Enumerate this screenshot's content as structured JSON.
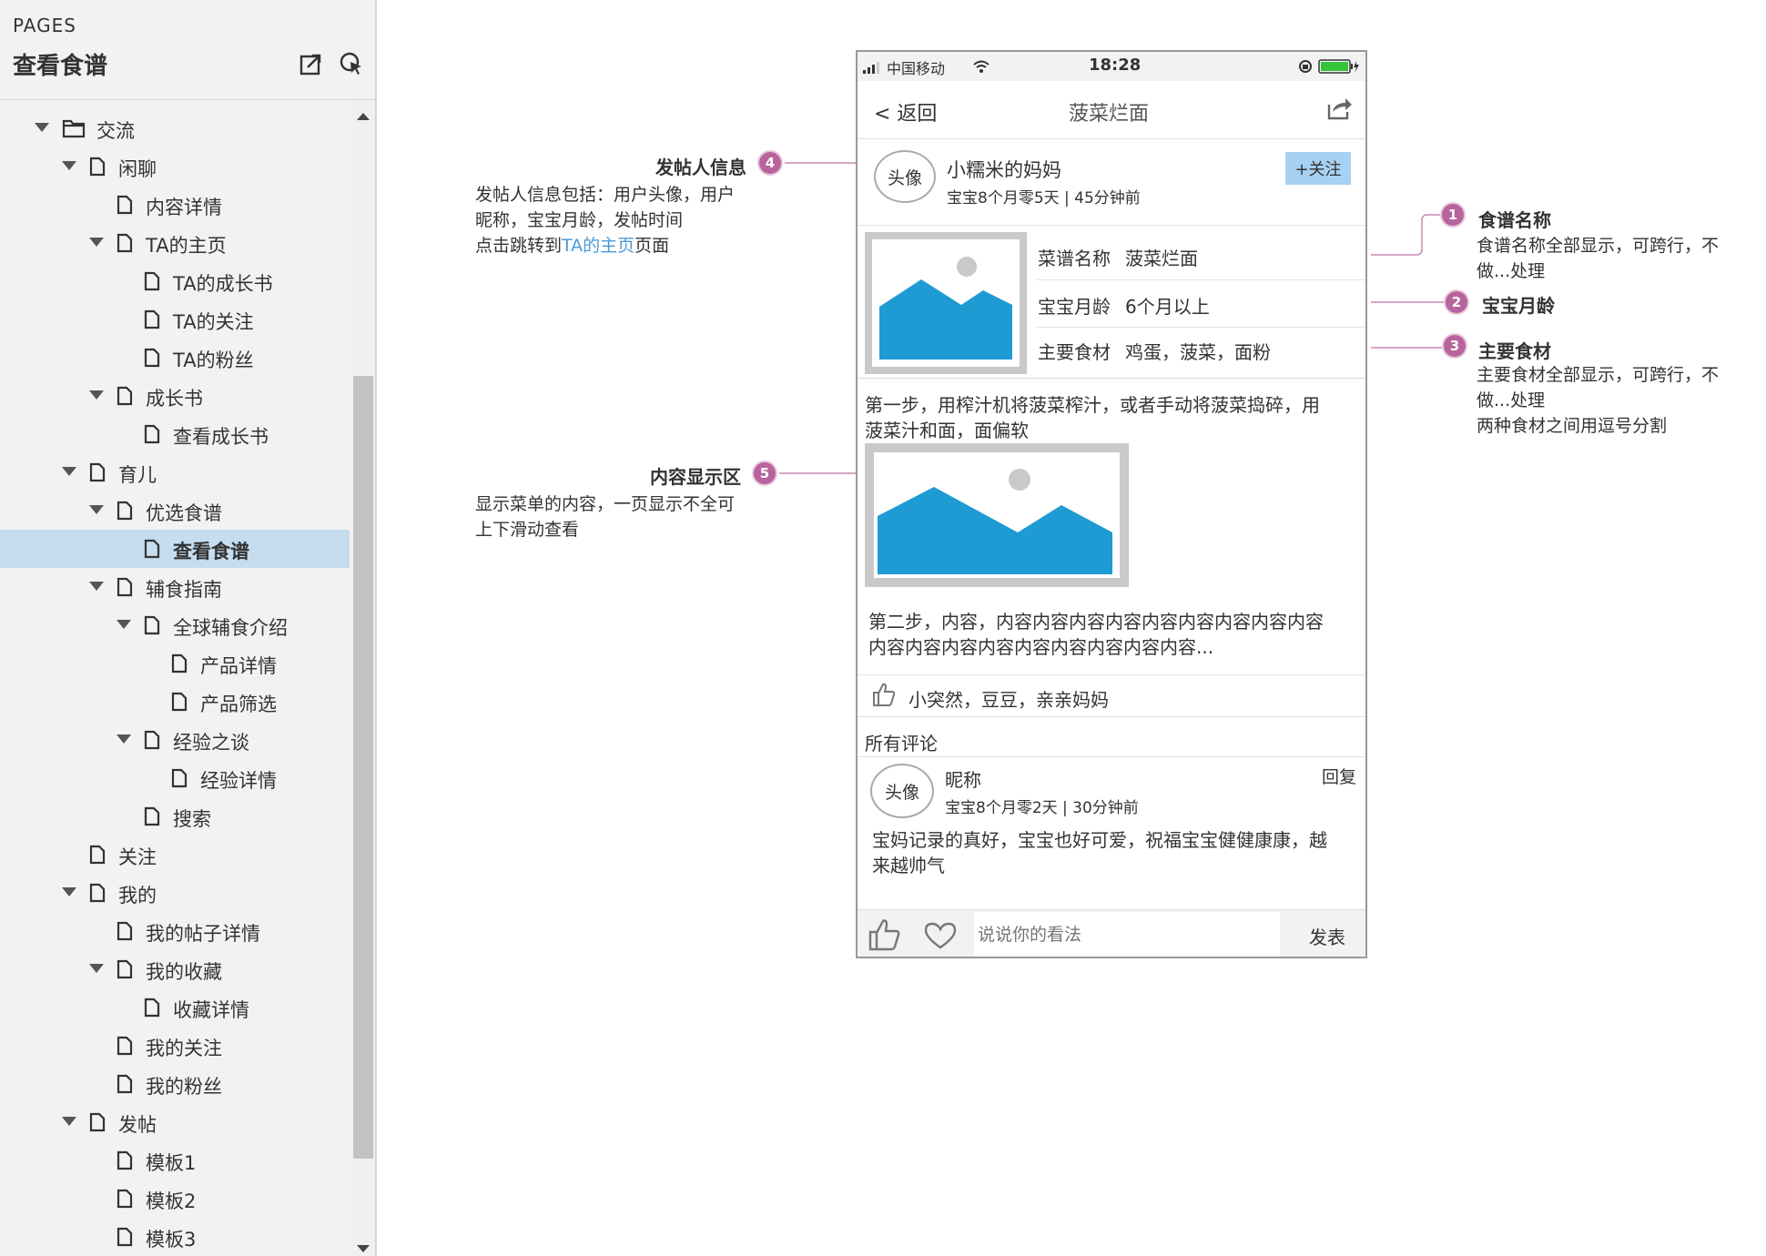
{
  "sidebar": {
    "pages_label": "PAGES",
    "title": "查看食谱",
    "tree": [
      {
        "label": "交流",
        "level": 0,
        "type": "folder",
        "expanded": true
      },
      {
        "label": "闲聊",
        "level": 1,
        "type": "page",
        "expanded": true
      },
      {
        "label": "内容详情",
        "level": 2,
        "type": "page"
      },
      {
        "label": "TA的主页",
        "level": 2,
        "type": "page",
        "expanded": true
      },
      {
        "label": "TA的成长书",
        "level": 3,
        "type": "page"
      },
      {
        "label": "TA的关注",
        "level": 3,
        "type": "page"
      },
      {
        "label": "TA的粉丝",
        "level": 3,
        "type": "page"
      },
      {
        "label": "成长书",
        "level": 2,
        "type": "page",
        "expanded": true
      },
      {
        "label": "查看成长书",
        "level": 3,
        "type": "page"
      },
      {
        "label": "育儿",
        "level": 1,
        "type": "page",
        "expanded": true
      },
      {
        "label": "优选食谱",
        "level": 2,
        "type": "page",
        "expanded": true
      },
      {
        "label": "查看食谱",
        "level": 3,
        "type": "page",
        "selected": true
      },
      {
        "label": "辅食指南",
        "level": 2,
        "type": "page",
        "expanded": true
      },
      {
        "label": "全球辅食介绍",
        "level": 3,
        "type": "page",
        "expanded": true
      },
      {
        "label": "产品详情",
        "level": 4,
        "type": "page"
      },
      {
        "label": "产品筛选",
        "level": 4,
        "type": "page"
      },
      {
        "label": "经验之谈",
        "level": 3,
        "type": "page",
        "expanded": true
      },
      {
        "label": "经验详情",
        "level": 4,
        "type": "page"
      },
      {
        "label": "搜索",
        "level": 3,
        "type": "page"
      },
      {
        "label": "关注",
        "level": 1,
        "type": "page"
      },
      {
        "label": "我的",
        "level": 1,
        "type": "page",
        "expanded": true
      },
      {
        "label": "我的帖子详情",
        "level": 2,
        "type": "page"
      },
      {
        "label": "我的收藏",
        "level": 2,
        "type": "page",
        "expanded": true
      },
      {
        "label": "收藏详情",
        "level": 3,
        "type": "page"
      },
      {
        "label": "我的关注",
        "level": 2,
        "type": "page"
      },
      {
        "label": "我的粉丝",
        "level": 2,
        "type": "page"
      },
      {
        "label": "发帖",
        "level": 1,
        "type": "page",
        "expanded": true
      },
      {
        "label": "模板1",
        "level": 2,
        "type": "page"
      },
      {
        "label": "模板2",
        "level": 2,
        "type": "page"
      },
      {
        "label": "模板3",
        "level": 2,
        "type": "page"
      }
    ],
    "icons": [
      "export-icon",
      "pointer-icon"
    ]
  },
  "phone": {
    "status": {
      "carrier": "中国移动",
      "time": "18:28"
    },
    "nav": {
      "back": "< 返回",
      "title": "菠菜烂面"
    },
    "poster": {
      "avatar": "头像",
      "name": "小糯米的妈妈",
      "meta": "宝宝8个月零5天 |  45分钟前",
      "follow": "+关注"
    },
    "recipe": {
      "name_label": "菜谱名称",
      "name_value": "菠菜烂面",
      "age_label": "宝宝月龄",
      "age_value": "6个月以上",
      "ingredients_label": "主要食材",
      "ingredients_value": "鸡蛋，菠菜，面粉"
    },
    "steps": {
      "step1_line1": "第一步，用榨汁机将菠菜榨汁，或者手动将菠菜捣碎，用",
      "step1_line2": "菠菜汁和面，面偏软",
      "step2_line1": "第二步，内容，内容内容内容内容内容内容内容内容内容",
      "step2_line2": "内容内容内容内容内容内容内容内容内容..."
    },
    "likes": "小突然，豆豆，亲亲妈妈",
    "comments_header": "所有评论",
    "comment": {
      "avatar": "头像",
      "name": "昵称",
      "reply": "回复",
      "meta": "宝宝8个月零2天 |  30分钟前",
      "text_line1": "宝妈记录的真好，宝宝也好可爱，祝福宝宝健健康康，越",
      "text_line2": "来越帅气"
    },
    "input_placeholder": "说说你的看法",
    "send": "发表"
  },
  "annotations": {
    "a4": {
      "num": "4",
      "title": "发帖人信息",
      "line1": "发帖人信息包括：用户头像，用户",
      "line2": "昵称，宝宝月龄，发帖时间",
      "line3_pre": "点击跳转到",
      "line3_link": "TA的主页",
      "line3_post": "页面"
    },
    "a5": {
      "num": "5",
      "title": "内容显示区",
      "line1": "显示菜单的内容，一页显示不全可",
      "line2": "上下滑动查看"
    },
    "a1": {
      "num": "1",
      "title": "食谱名称",
      "line1": "食谱名称全部显示，可跨行，不",
      "line2": "做...处理"
    },
    "a2": {
      "num": "2",
      "title": "宝宝月龄"
    },
    "a3": {
      "num": "3",
      "title": "主要食材",
      "line1": "主要食材全部显示，可跨行，不",
      "line2": "做...处理",
      "line3": "两种食材之间用逗号分割"
    }
  },
  "colors": {
    "accent": "#b8649c",
    "selected": "#c6dcef",
    "follow": "#a7d1f3",
    "image": "#1e9bd3",
    "link": "#4a9ad8"
  }
}
